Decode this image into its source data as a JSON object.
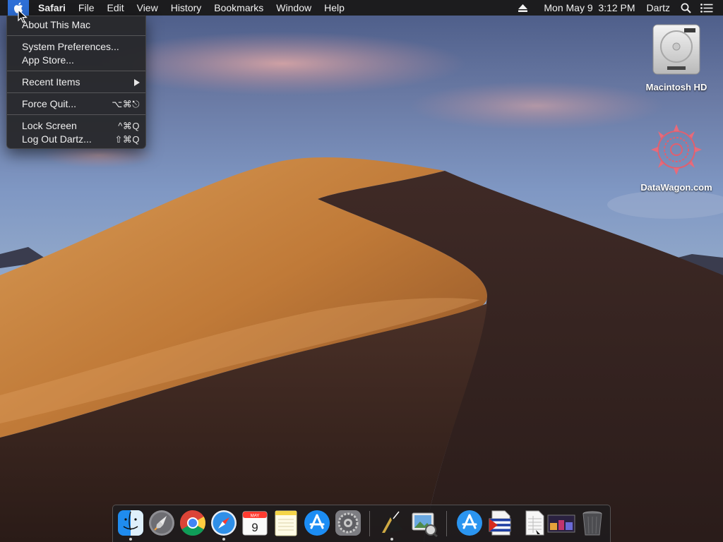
{
  "menubar": {
    "app_name": "Safari",
    "menus": [
      "File",
      "Edit",
      "View",
      "History",
      "Bookmarks",
      "Window",
      "Help"
    ],
    "datetime": "Mon May 9  3:12 PM",
    "user": "Dartz",
    "icons": [
      "apple-icon",
      "eject-icon",
      "spotlight-search-icon",
      "notification-center-icon"
    ],
    "accent_color": "#2e6fd6"
  },
  "apple_menu": {
    "items": [
      {
        "label": "About This Mac",
        "shortcut": ""
      },
      {
        "label": "System Preferences...",
        "shortcut": ""
      },
      {
        "label": "App Store...",
        "shortcut": ""
      },
      {
        "label": "Recent Items",
        "shortcut": ""
      },
      {
        "label": "Force Quit...",
        "shortcut": "⌥⌘⎋"
      },
      {
        "label": "Lock Screen",
        "shortcut": "^⌘Q"
      },
      {
        "label": "Log Out Dartz...",
        "shortcut": "⇧⌘Q"
      }
    ]
  },
  "desktop": {
    "icons": [
      {
        "label": "Macintosh HD",
        "icon": "hard-drive-icon"
      },
      {
        "label": "DataWagon.com",
        "icon": "datawagon-logo-icon"
      }
    ]
  },
  "dock": {
    "apps": [
      {
        "name": "Finder",
        "icon": "finder-icon",
        "running": true
      },
      {
        "name": "Launchpad",
        "icon": "launchpad-icon",
        "running": false
      },
      {
        "name": "Google Chrome",
        "icon": "chrome-icon",
        "running": false
      },
      {
        "name": "Safari",
        "icon": "safari-icon",
        "running": true
      },
      {
        "name": "Calendar",
        "icon": "calendar-icon",
        "running": false
      },
      {
        "name": "Notes",
        "icon": "notes-icon",
        "running": false
      },
      {
        "name": "App Store",
        "icon": "app-store-icon",
        "running": false
      },
      {
        "name": "System Preferences",
        "icon": "system-preferences-icon",
        "running": false
      },
      {
        "name": "Terminal",
        "icon": "terminal-icon",
        "running": true
      },
      {
        "name": "Preview",
        "icon": "preview-icon",
        "running": false
      },
      {
        "name": "App Store Folder",
        "icon": "app-store-folder-icon",
        "running": false
      },
      {
        "name": "Document",
        "icon": "flag-document-icon",
        "running": false
      },
      {
        "name": "Spreadsheet",
        "icon": "document-icon",
        "running": false
      },
      {
        "name": "Image",
        "icon": "image-thumbnail-icon",
        "running": false
      },
      {
        "name": "Trash",
        "icon": "trash-icon",
        "running": false
      }
    ],
    "calendar_month": "MAY",
    "calendar_day": "9"
  }
}
